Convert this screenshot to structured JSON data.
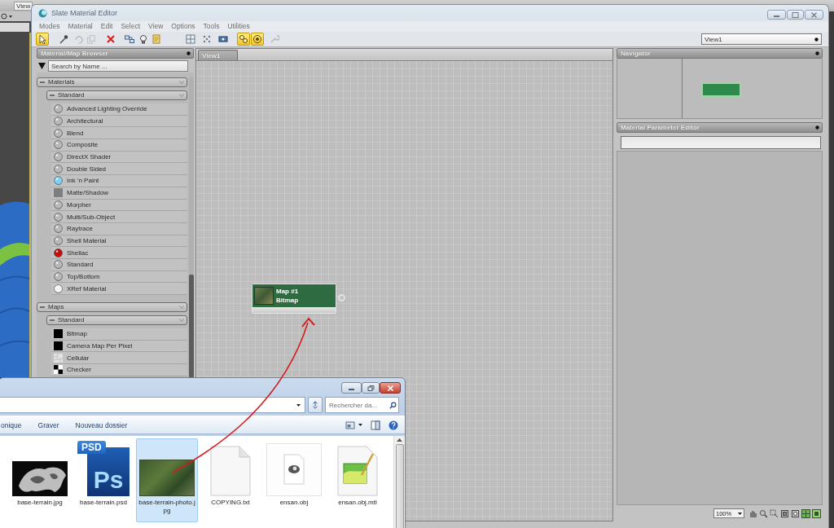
{
  "app_window": {
    "viewport_label": "View"
  },
  "window": {
    "title": "Slate Material Editor"
  },
  "menu": [
    "Modes",
    "Material",
    "Edit",
    "Select",
    "View",
    "Options",
    "Tools",
    "Utilities"
  ],
  "toolbar": [
    {
      "kind": "select",
      "on": true,
      "disabled": false
    },
    {
      "kind": "eyedropper",
      "on": false,
      "disabled": false
    },
    {
      "kind": "undo",
      "on": false,
      "disabled": true
    },
    {
      "kind": "copy",
      "on": false,
      "disabled": true
    },
    {
      "kind": "delete",
      "on": false,
      "disabled": false
    },
    {
      "kind": "layout",
      "on": false,
      "disabled": false
    },
    {
      "kind": "bulb",
      "on": false,
      "disabled": false
    },
    {
      "kind": "page",
      "on": false,
      "disabled": false
    },
    {
      "kind": "grid",
      "on": false,
      "disabled": false
    },
    {
      "kind": "dots",
      "on": false,
      "disabled": false
    },
    {
      "kind": "node",
      "on": false,
      "disabled": false
    },
    {
      "kind": "link",
      "on": true,
      "disabled": false
    },
    {
      "kind": "target",
      "on": true,
      "disabled": false
    },
    {
      "kind": "wrench",
      "on": false,
      "disabled": true
    }
  ],
  "view_select": {
    "value": "View1"
  },
  "browser": {
    "title": "Material/Map Browser",
    "search": {
      "placeholder": "Search by Name ..."
    },
    "groups": [
      {
        "label": "Materials",
        "expanded": true,
        "children": [
          {
            "label": "Standard",
            "expanded": true,
            "children": [
              {
                "label": "Advanced Lighting Override",
                "kind": "sphere",
                "color": "#b8b8b8"
              },
              {
                "label": "Architectural",
                "kind": "sphere",
                "color": "#b8b8b8"
              },
              {
                "label": "Blend",
                "kind": "sphere",
                "color": "#b8b8b8"
              },
              {
                "label": "Composite",
                "kind": "sphere",
                "color": "#b8b8b8"
              },
              {
                "label": "DirectX Shader",
                "kind": "sphere",
                "color": "#b8b8b8"
              },
              {
                "label": "Double Sided",
                "kind": "sphere",
                "color": "#b8b8b8"
              },
              {
                "label": "Ink 'n Paint",
                "kind": "sphere",
                "color": "#7fd3f2"
              },
              {
                "label": "Matte/Shadow",
                "kind": "square",
                "color": "#7e7e7e"
              },
              {
                "label": "Morpher",
                "kind": "sphere",
                "color": "#b8b8b8"
              },
              {
                "label": "Multi/Sub-Object",
                "kind": "sphere",
                "color": "#b8b8b8"
              },
              {
                "label": "Raytrace",
                "kind": "sphere",
                "color": "#b8b8b8"
              },
              {
                "label": "Shell Material",
                "kind": "sphere",
                "color": "#b8b8b8"
              },
              {
                "label": "Shellac",
                "kind": "sphere",
                "color": "#cc0a0a"
              },
              {
                "label": "Standard",
                "kind": "sphere",
                "color": "#b8b8b8"
              },
              {
                "label": "Top/Bottom",
                "kind": "sphere",
                "color": "#b8b8b8"
              },
              {
                "label": "XRef Material",
                "kind": "sphere",
                "color": "#f4f4f4"
              }
            ]
          }
        ]
      },
      {
        "label": "Maps",
        "expanded": true,
        "children": [
          {
            "label": "Standard",
            "expanded": true,
            "children": [
              {
                "label": "Bitmap",
                "kind": "square",
                "color": "#000000"
              },
              {
                "label": "Camera Map Per Pixel",
                "kind": "square",
                "color": "#000000"
              },
              {
                "label": "Cellular",
                "kind": "cells",
                "color": "#e2e2e2"
              },
              {
                "label": "Checker",
                "kind": "checker",
                "color": "#000000"
              }
            ]
          }
        ]
      }
    ]
  },
  "view_tabs": [
    {
      "label": "View1",
      "selected": true
    }
  ],
  "nodes": [
    {
      "title": "Map #1",
      "type": "Bitmap"
    }
  ],
  "navigator": {
    "title": "Navigator"
  },
  "parameter_editor": {
    "title": "Material Parameter Editor"
  },
  "zoom": {
    "value": "100%"
  },
  "explorer": {
    "search": {
      "placeholder": "Rechercher da..."
    },
    "commands": [
      "onique",
      "Graver",
      "Nouveau dossier"
    ],
    "files": [
      {
        "name": "base-terrain.jpg",
        "kind": "heightmap",
        "selected": false
      },
      {
        "name": "base-terrain.psd",
        "kind": "psd",
        "selected": false,
        "badge": "PSD",
        "logo": "Ps"
      },
      {
        "name": "base-terrain-photo.jpg",
        "kind": "photo",
        "selected": true
      },
      {
        "name": "COPYING.txt",
        "kind": "text",
        "selected": false
      },
      {
        "name": "ensan.obj",
        "kind": "obj",
        "selected": false
      },
      {
        "name": "ensan.obj.mtl",
        "kind": "mtl",
        "selected": false
      }
    ]
  }
}
